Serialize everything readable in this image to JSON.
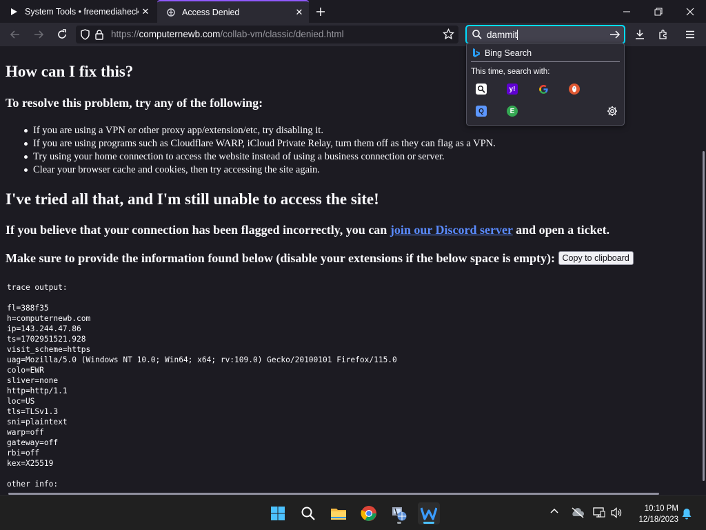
{
  "tabs": [
    {
      "title": "System Tools • freemediahecky",
      "icon": "play-icon",
      "active": false
    },
    {
      "title": "Access Denied",
      "icon": "page-icon",
      "active": true
    }
  ],
  "window_controls": [
    "minimize",
    "restore",
    "close"
  ],
  "nav": {
    "url_scheme": "https://",
    "url_host": "computernewb.com",
    "url_path": "/collab-vm/classic/denied.html",
    "search_value": "dammit"
  },
  "search_dropdown": {
    "suggestion": "Bing Search",
    "search_with_label": "This time, search with:",
    "engines": [
      "search-icon",
      "yahoo-icon",
      "google-icon",
      "duckduckgo-icon",
      "qwant-icon",
      "ecosia-icon"
    ]
  },
  "page": {
    "fix_heading": "How can I fix this?",
    "resolve_heading": "To resolve this problem, try any of the following:",
    "steps": [
      "If you are using a VPN or other proxy app/extension/etc, try disabling it.",
      "If you are using programs such as Cloudflare WARP, iCloud Private Relay, turn them off as they can flag as a VPN.",
      "Try using your home connection to access the website instead of using a business connection or server.",
      "Clear your browser cache and cookies, then try accessing the site again."
    ],
    "tried_heading": "I've tried all that, and I'm still unable to access the site!",
    "flagged_prefix": "If you believe that your connection has been flagged incorrectly, you can ",
    "discord_link": "join our Discord server",
    "flagged_suffix": " and open a ticket.",
    "provide_text": "Make sure to provide the information found below (disable your extensions if the below space is empty):",
    "copy_button": "Copy to clipboard",
    "trace": "trace output:\n\nfl=388f35\nh=computernewb.com\nip=143.244.47.86\nts=1702951521.928\nvisit_scheme=https\nuag=Mozilla/5.0 (Windows NT 10.0; Win64; x64; rv:109.0) Gecko/20100101 Firefox/115.0\ncolo=EWR\nsliver=none\nhttp=http/1.1\nloc=US\ntls=TLSv1.3\nsni=plaintext\nwarp=off\ngateway=off\nrbi=off\nkex=X25519\n\nother info:"
  },
  "taskbar": {
    "apps": [
      "windows-start-icon",
      "search-icon",
      "file-explorer-icon",
      "chrome-icon",
      "network-app-icon",
      "wingdings-w-icon"
    ],
    "time": "10:10 PM",
    "date": "12/18/2023"
  },
  "colors": {
    "accent": "#00ddff",
    "link": "#5a8bff",
    "background": "#1c1b22",
    "toolbar": "#2b2a33"
  }
}
